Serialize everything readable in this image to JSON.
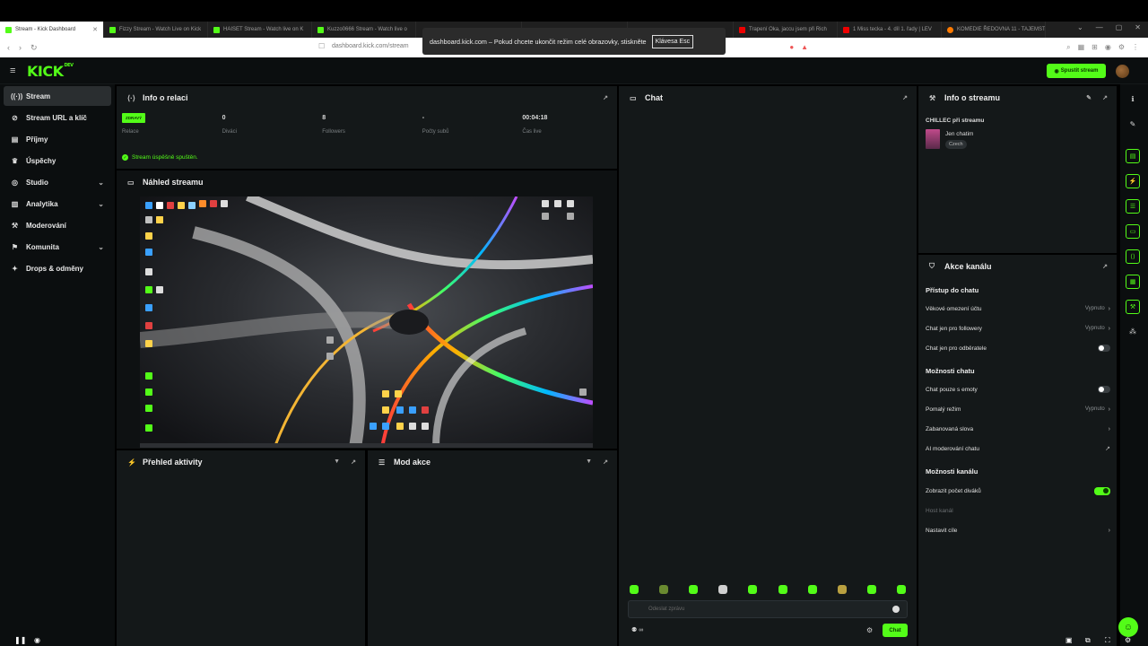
{
  "browser": {
    "tabs": [
      {
        "title": "Stream - Kick Dashboard",
        "icon": "kick-favicon"
      },
      {
        "title": "Fizzy Stream - Watch Live on Kick",
        "icon": "kick-favicon"
      },
      {
        "title": "HAISET Stream - Watch live on K",
        "icon": "kick-favicon"
      },
      {
        "title": "Kuzzo0666 Stream - Watch live o",
        "icon": "kick-favicon"
      },
      {
        "title": "",
        "icon": ""
      },
      {
        "title": "",
        "icon": ""
      },
      {
        "title": "",
        "icon": ""
      },
      {
        "title": "Trapení Oka, jaccu jsem při Rich",
        "icon": "youtube-favicon"
      },
      {
        "title": "1 Miss tecka - 4. díl 1. řady | LEV",
        "icon": "youtube-favicon"
      },
      {
        "title": "KOMEDIE ŘEDOVNA 11 - TAJEMST",
        "icon": "kiwi-favicon"
      }
    ],
    "url": "dashboard.kick.com/stream",
    "fullscreen_toast": {
      "message": "dashboard.kick.com – Pokud chcete ukončit režim celé obrazovky, stiskněte",
      "key": "Klávesa Esc"
    }
  },
  "header": {
    "logo": "KICK",
    "logo_sup": "DEV",
    "start_stream_label": "Spustit stream"
  },
  "sidebar": {
    "items": [
      {
        "label": "Stream",
        "icon": "broadcast-icon",
        "active": true
      },
      {
        "label": "Stream URL a klíč",
        "icon": "link-icon"
      },
      {
        "label": "Příjmy",
        "icon": "wallet-icon"
      },
      {
        "label": "Úspěchy",
        "icon": "trophy-icon"
      },
      {
        "label": "Studio",
        "icon": "studio-icon",
        "expandable": true
      },
      {
        "label": "Analytika",
        "icon": "analytics-icon",
        "expandable": true
      },
      {
        "label": "Moderování",
        "icon": "wrench-icon"
      },
      {
        "label": "Komunita",
        "icon": "community-icon",
        "expandable": true
      },
      {
        "label": "Drops & odměny",
        "icon": "gift-icon"
      }
    ]
  },
  "session_info": {
    "title": "Info o relaci",
    "live_badge": "ZDRAVÝ",
    "stats": [
      {
        "value": "",
        "label": "Relace"
      },
      {
        "value": "0",
        "label": "Diváci"
      },
      {
        "value": "8",
        "label": "Followers"
      },
      {
        "value": "-",
        "label": "Počty subů"
      },
      {
        "value": "00:04:18",
        "label": "Čas live"
      }
    ],
    "status": "Stream úspěšně spuštěn."
  },
  "preview": {
    "title": "Náhled streamu"
  },
  "activity": {
    "title": "Přehled aktivity"
  },
  "mod_actions": {
    "title": "Mod akce"
  },
  "chat": {
    "title": "Chat",
    "input_placeholder": "Odeslat zprávu",
    "send_label": "Chat"
  },
  "stream_info": {
    "title": "Info o streamu",
    "stream_title": "CHILLEC při streamu",
    "category": "Jen chatim",
    "language_tag": "Czech"
  },
  "channel_actions": {
    "title": "Akce kanálu",
    "sections": [
      {
        "title": "Přístup do chatu",
        "rows": [
          {
            "label": "Věkové omezení účtu",
            "value": "Vypnuto",
            "control": "chevron"
          },
          {
            "label": "Chat jen pro followery",
            "value": "Vypnuto",
            "control": "chevron"
          },
          {
            "label": "Chat jen pro odběratele",
            "value": "",
            "control": "toggle-off"
          }
        ]
      },
      {
        "title": "Možnosti chatu",
        "rows": [
          {
            "label": "Chat pouze s emoty",
            "value": "",
            "control": "toggle-off"
          },
          {
            "label": "Pomalý režim",
            "value": "Vypnuto",
            "control": "chevron"
          },
          {
            "label": "Zabanovaná slova",
            "value": "",
            "control": "chevron"
          },
          {
            "label": "AI moderování chatu",
            "value": "",
            "control": "external"
          }
        ]
      },
      {
        "title": "Možnosti kanálu",
        "rows": [
          {
            "label": "Zobrazit počet diváků",
            "value": "",
            "control": "toggle-on"
          },
          {
            "label": "Host kanál",
            "value": "",
            "control": "none",
            "disabled": true
          },
          {
            "label": "Nastavit cíle",
            "value": "",
            "control": "chevron"
          }
        ]
      }
    ]
  },
  "colors": {
    "accent": "#53fc18",
    "background": "#0b0e0f",
    "panel": "#141819"
  }
}
